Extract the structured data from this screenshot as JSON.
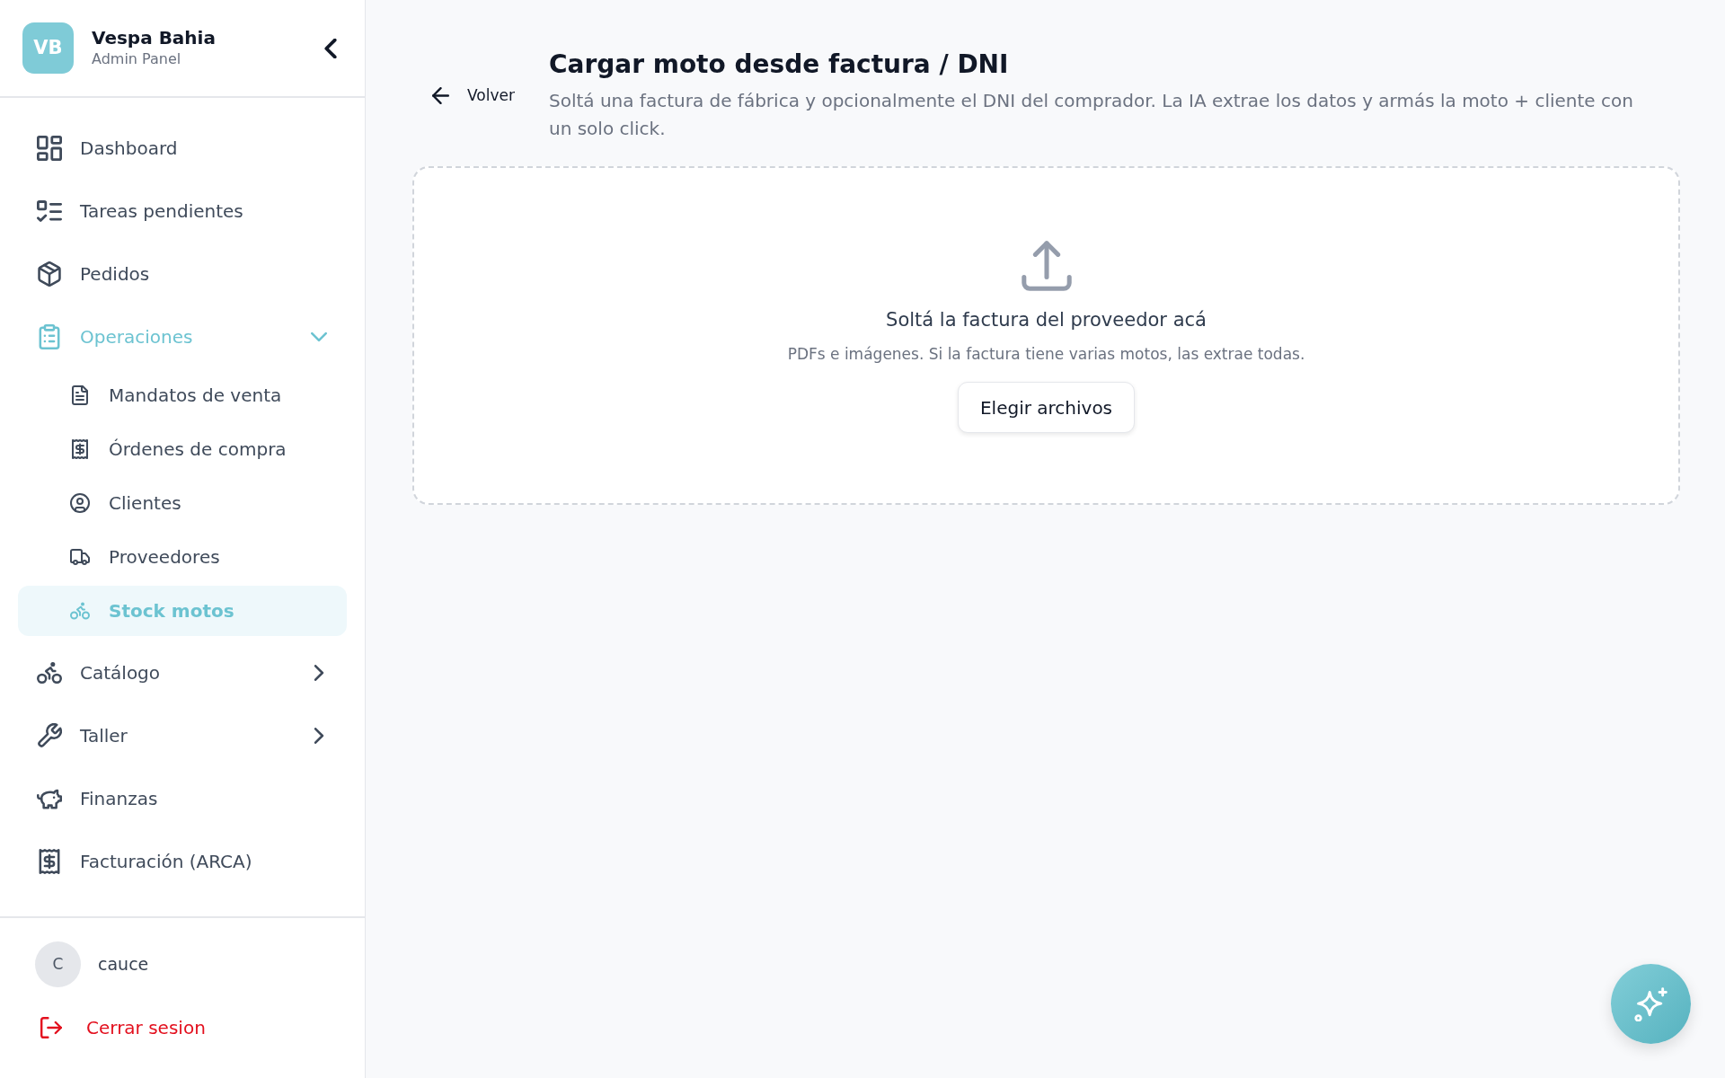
{
  "sidebar": {
    "brand": {
      "initials": "VB",
      "name": "Vespa Bahia",
      "subtitle": "Admin Panel"
    },
    "nav": [
      {
        "kind": "link",
        "label": "Dashboard",
        "selected": false
      },
      {
        "kind": "link",
        "label": "Tareas pendientes",
        "selected": false
      },
      {
        "kind": "link",
        "label": "Pedidos",
        "selected": false
      },
      {
        "kind": "group",
        "label": "Operaciones",
        "selected": false,
        "expanded": true,
        "children": [
          {
            "label": "Mandatos de venta",
            "selected": false
          },
          {
            "label": "Órdenes de compra",
            "selected": false
          },
          {
            "label": "Clientes",
            "selected": false
          },
          {
            "label": "Proveedores",
            "selected": false
          },
          {
            "label": "Stock motos",
            "selected": true
          }
        ]
      },
      {
        "kind": "group",
        "label": "Catálogo",
        "selected": false,
        "expanded": false
      },
      {
        "kind": "group",
        "label": "Taller",
        "selected": false,
        "expanded": false
      },
      {
        "kind": "link",
        "label": "Finanzas",
        "selected": false
      },
      {
        "kind": "link",
        "label": "Facturación (ARCA)",
        "selected": false
      }
    ],
    "user": {
      "initial": "C",
      "name": "cauce"
    },
    "logout": {
      "label": "Cerrar sesion"
    }
  },
  "main": {
    "back": {
      "label": "Volver"
    },
    "title": "Cargar moto desde factura / DNI",
    "description": "Soltá una factura de fábrica y opcionalmente el DNI del comprador. La IA extrae los datos y armás la moto + cliente con un solo click.",
    "dropzone": {
      "title": "Soltá la factura del proveedor acá",
      "hint": "PDFs e imágenes. Si la factura tiene varias motos, las extrae todas.",
      "button": "Elegir archivos"
    }
  }
}
